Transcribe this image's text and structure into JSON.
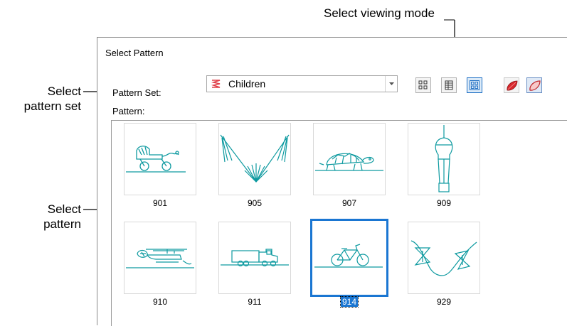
{
  "callouts": {
    "viewing_mode": "Select viewing mode",
    "pattern_set": [
      "Select",
      "pattern set"
    ],
    "pattern": [
      "Select",
      "pattern"
    ]
  },
  "dialog": {
    "title": "Select Pattern",
    "pattern_set_label": "Pattern Set:",
    "pattern_set_value": "Children",
    "pattern_label": "Pattern:",
    "toolbar": {
      "view_modes": [
        "small-icons-view-icon",
        "list-view-icon",
        "large-icons-view-icon"
      ],
      "active_view": "large-icons-view-icon",
      "shapes": [
        "filled-leaf-shape-icon",
        "outline-leaf-shape-icon"
      ],
      "active_shape": "outline-leaf-shape-icon"
    },
    "accent_color": "#1a76d2",
    "pattern_color": "#0e9aa0",
    "patterns": [
      {
        "id": "901",
        "icon": "baby-carriage-pattern"
      },
      {
        "id": "905",
        "icon": "v-fan-pattern"
      },
      {
        "id": "907",
        "icon": "turtle-pattern"
      },
      {
        "id": "909",
        "icon": "hot-air-balloon-pattern"
      },
      {
        "id": "910",
        "icon": "helicopter-pattern"
      },
      {
        "id": "911",
        "icon": "truck-pattern"
      },
      {
        "id": "914",
        "icon": "bicycle-pattern",
        "selected": true
      },
      {
        "id": "929",
        "icon": "bowtie-wave-pattern"
      }
    ]
  }
}
